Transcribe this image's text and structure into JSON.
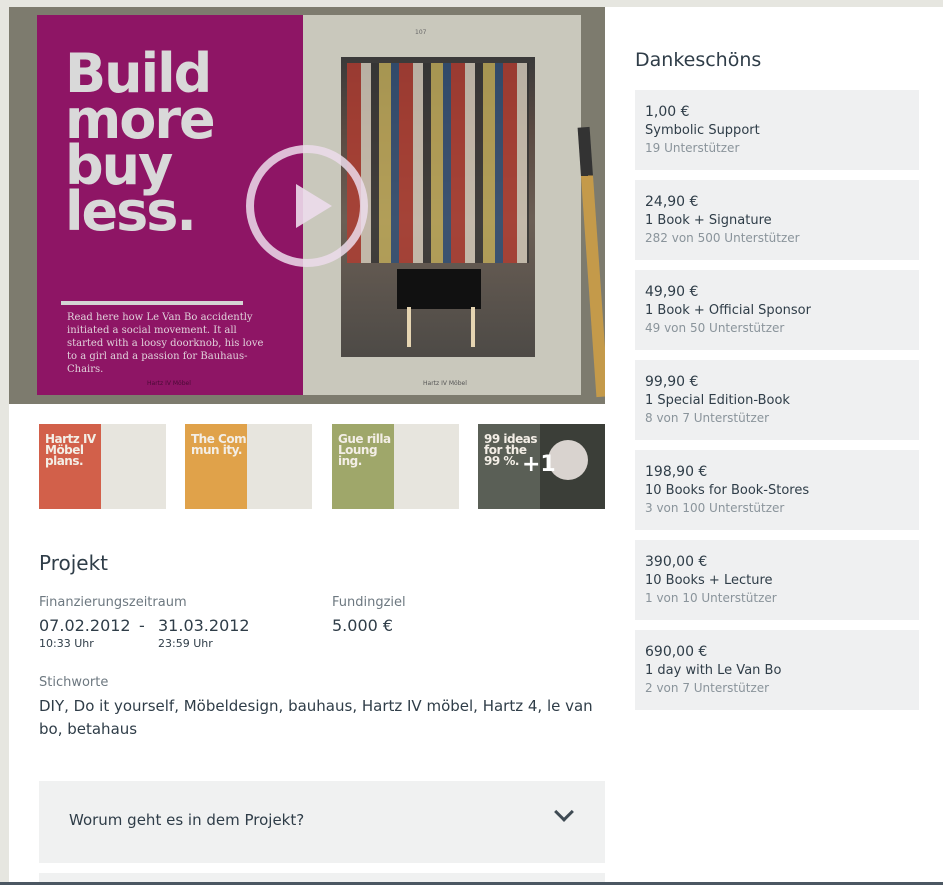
{
  "hero": {
    "book_title": "Build more buy less.",
    "book_blurb": "Read here how Le Van Bo accidently initiated a social movement. It all started with a loosy doorknob, his love to a girl and a passion for Bauhaus-Chairs.",
    "left_footer": "Hartz IV Möbel",
    "right_footer": "Hartz IV Möbel",
    "page_number": "107"
  },
  "thumbnails": [
    {
      "title": "Hartz IV Möbel plans.",
      "color": "#d2604a"
    },
    {
      "title": "The Com mun ity.",
      "color": "#e0a24a"
    },
    {
      "title": "Gue rilla Loung ing.",
      "color": "#9fa76a"
    },
    {
      "title": "99 ideas for the 99 %.",
      "color": "#5a5f56",
      "more": "+1"
    }
  ],
  "projekt": {
    "title": "Projekt",
    "period_label": "Finanzierungszeitraum",
    "start_date": "07.02.2012",
    "separator": "-",
    "end_date": "31.03.2012",
    "start_time": "10:33 Uhr",
    "end_time": "23:59 Uhr",
    "goal_label": "Fundingziel",
    "goal_value": "5.000 €",
    "tags_label": "Stichworte",
    "tags": "DIY, Do it yourself, Möbeldesign, bauhaus, Hartz IV möbel, Hartz 4, le van bo, betahaus",
    "accordion_question": "Worum geht es in dem Projekt?"
  },
  "sidebar": {
    "title": "Dankeschöns",
    "rewards": [
      {
        "price": "1,00 €",
        "name": "Symbolic Support",
        "supporters": "19 Unterstützer"
      },
      {
        "price": "24,90 €",
        "name": "1 Book + Signature",
        "supporters": "282 von 500 Unterstützer"
      },
      {
        "price": "49,90 €",
        "name": "1 Book + Official Sponsor",
        "supporters": "49 von 50 Unterstützer"
      },
      {
        "price": "99,90 €",
        "name": "1 Special Edition-Book",
        "supporters": "8 von 7 Unterstützer"
      },
      {
        "price": "198,90 €",
        "name": "10 Books for Book-Stores",
        "supporters": "3 von 100 Unterstützer"
      },
      {
        "price": "390,00 €",
        "name": "10 Books + Lecture",
        "supporters": "1 von 10 Unterstützer"
      },
      {
        "price": "690,00 €",
        "name": "1 day with Le Van Bo",
        "supporters": "2 von 7 Unterstützer"
      }
    ]
  }
}
